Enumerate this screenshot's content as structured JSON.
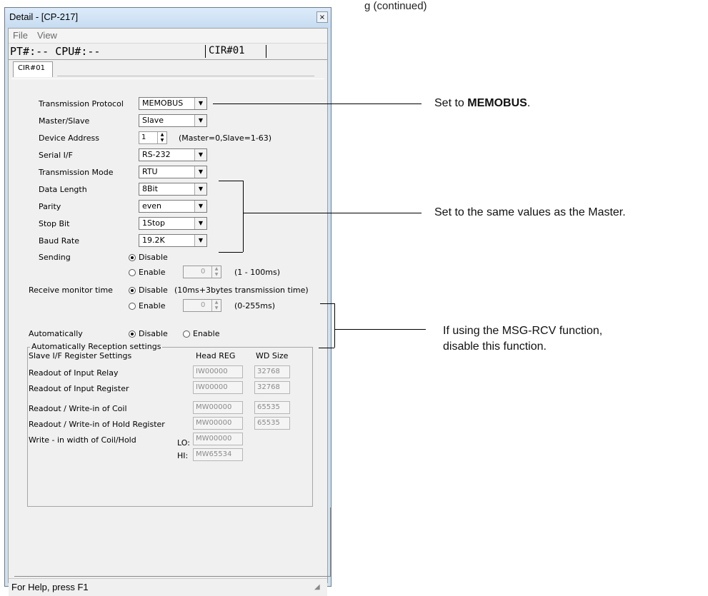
{
  "page": {
    "top_caption": "g (continued)"
  },
  "window": {
    "title": "Detail - [CP-217]",
    "close_label": "×",
    "menu": [
      "File",
      "View"
    ],
    "info_left": "PT#:-- CPU#:--",
    "info_cir": "CIR#01",
    "tab": "CIR#01"
  },
  "settings": {
    "protocol": {
      "label": "Transmission Protocol",
      "value": "MEMOBUS"
    },
    "master_slave": {
      "label": "Master/Slave",
      "value": "Slave"
    },
    "device_address": {
      "label": "Device Address",
      "value": "1",
      "hint": "(Master=0,Slave=1-63)"
    },
    "serial_if": {
      "label": "Serial I/F",
      "value": "RS-232"
    },
    "transmission_mode": {
      "label": "Transmission Mode",
      "value": "RTU"
    },
    "data_length": {
      "label": "Data Length",
      "value": "8Bit"
    },
    "parity": {
      "label": "Parity",
      "value": "even"
    },
    "stop_bit": {
      "label": "Stop Bit",
      "value": "1Stop"
    },
    "baud_rate": {
      "label": "Baud Rate",
      "value": "19.2K"
    },
    "sending": {
      "label": "Sending",
      "disable": "Disable",
      "enable": "Enable",
      "spin": "0",
      "hint": "(1 - 100ms)"
    },
    "receive": {
      "label": "Receive monitor time",
      "disable": "Disable",
      "disable_hint": "(10ms+3bytes transmission time)",
      "enable": "Enable",
      "spin": "0",
      "hint": "(0-255ms)"
    },
    "auto": {
      "label": "Automatically",
      "disable": "Disable",
      "enable": "Enable"
    },
    "group": {
      "title": "Automatically Reception settings",
      "header_left": "Slave I/F Register Settings",
      "header_reg": "Head REG",
      "header_size": "WD Size",
      "rows": [
        {
          "label": "Readout of Input Relay",
          "reg": "IW00000",
          "size": "32768"
        },
        {
          "label": "Readout of Input Register",
          "reg": "IW00000",
          "size": "32768"
        },
        {
          "label": "Readout / Write-in of Coil",
          "reg": "MW00000",
          "size": "65535"
        },
        {
          "label": "Readout / Write-in of Hold Register",
          "reg": "MW00000",
          "size": "65535"
        }
      ],
      "width_label": "Write - in width of Coil/Hold",
      "lo_label": "LO:",
      "lo_value": "MW00000",
      "hi_label": "HI:",
      "hi_value": "MW65534"
    }
  },
  "status": "For Help, press F1",
  "annotations": {
    "a1_prefix": "Set to ",
    "a1_bold": "MEMOBUS",
    "a1_suffix": ".",
    "a2": "Set to the same values as the Master.",
    "a3_line1": "If using the MSG-RCV function,",
    "a3_line2": "disable this function."
  }
}
